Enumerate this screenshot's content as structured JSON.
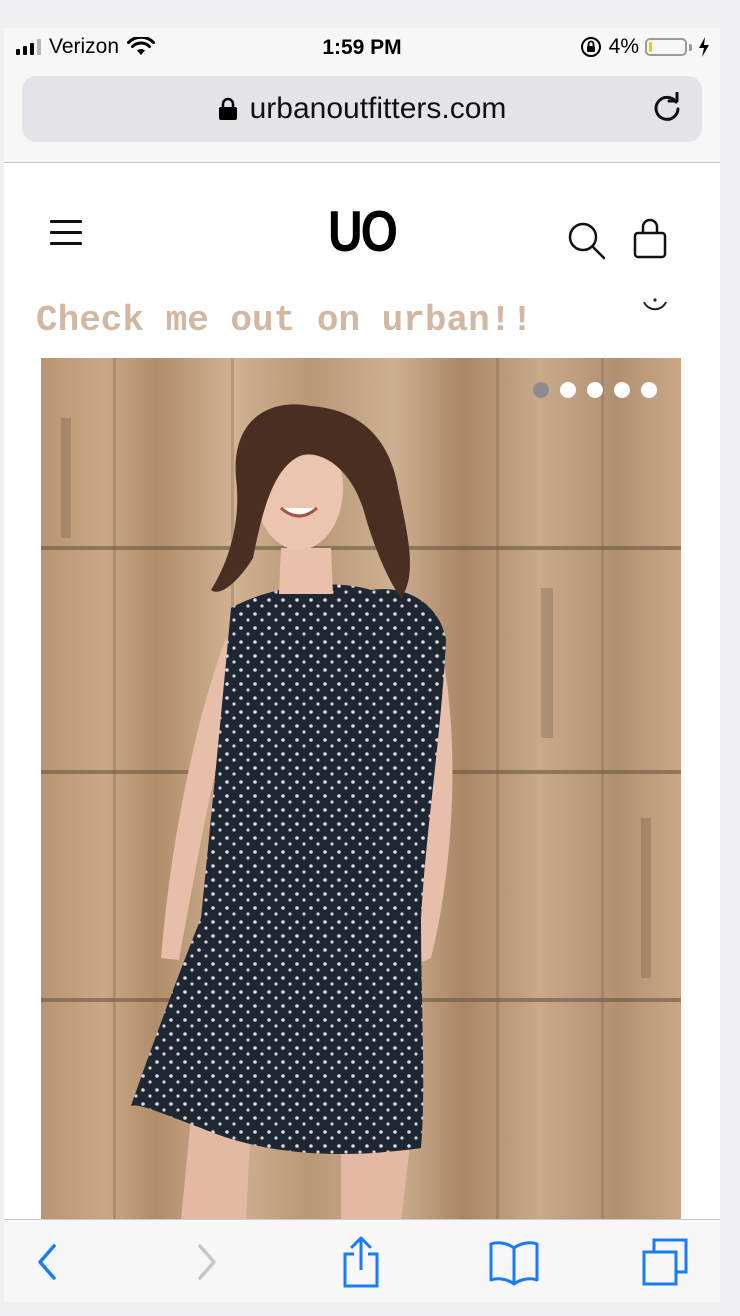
{
  "status_bar": {
    "carrier": "Verizon",
    "time": "1:59 PM",
    "battery": "4%",
    "battery_level": 0.04
  },
  "browser": {
    "url": "urbanoutfitters.com"
  },
  "site": {
    "logo": "UO"
  },
  "caption": "Check me out on urban!!",
  "carousel": {
    "total": 5,
    "active_index": 0
  },
  "icons": {
    "menu": "hamburger-menu-icon",
    "search": "search-icon",
    "bag": "shopping-bag-icon",
    "lock": "lock-icon",
    "reload": "reload-icon",
    "back": "back-chevron-icon",
    "forward": "forward-chevron-icon",
    "share": "share-icon",
    "bookmarks": "bookmarks-icon",
    "tabs": "tabs-icon"
  },
  "colors": {
    "accent": "#1a7cf5",
    "caption": "#d2b7a3"
  }
}
